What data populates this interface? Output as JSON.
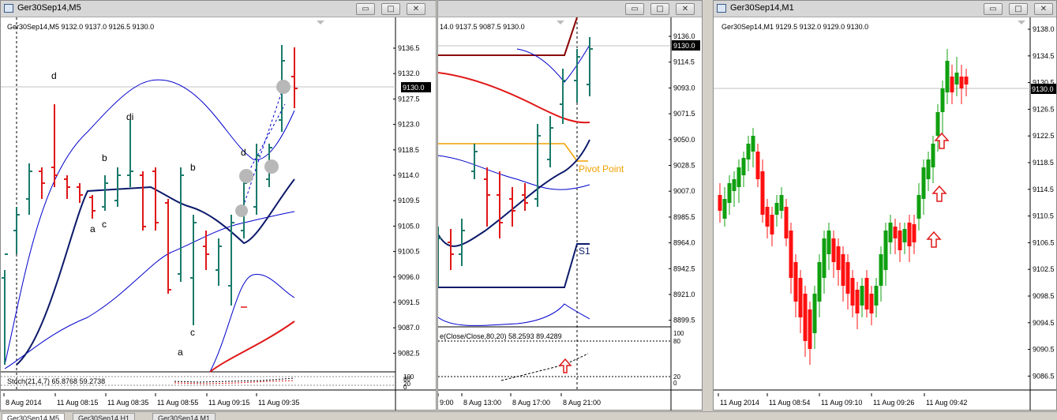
{
  "windows": [
    {
      "title": "Ger30Sep14,M5",
      "info": "Ger30Sep14,M5  9132.0 9137.0 9126.5 9130.0",
      "sub_info": "Stoch(21,4,7) 65.8768 59.2738",
      "price_ticks": [
        "9136.5",
        "9132.0",
        "9127.5",
        "9123.0",
        "9118.5",
        "9114.0",
        "9109.5",
        "9105.0",
        "9100.5",
        "9096.0",
        "9091.5",
        "9087.0",
        "9082.5"
      ],
      "current_price": "9130.0",
      "sub_ticks": [
        "100",
        "80",
        "20",
        "0"
      ],
      "time_ticks": [
        "8 Aug 2014",
        "11 Aug 08:15",
        "11 Aug 08:35",
        "11 Aug 08:55",
        "11 Aug 09:15",
        "11 Aug 09:35"
      ],
      "labels": [
        "d",
        "di",
        "b",
        "b",
        "d",
        "a",
        "c",
        "a",
        "c"
      ]
    },
    {
      "title": "",
      "info": "14.0 9137.5 9087.5 9130.0",
      "sub_info": "e(Close/Close,80,20) 58.2593 89.4289",
      "price_ticks": [
        "9136.0",
        "9114.5",
        "9093.0",
        "9071.5",
        "9050.0",
        "9028.5",
        "9007.0",
        "8985.5",
        "8964.0",
        "8942.5",
        "8921.0",
        "8899.5"
      ],
      "current_price": "9130.0",
      "sub_ticks": [
        "100",
        "80",
        "20",
        "0"
      ],
      "time_ticks": [
        "9:00",
        "8 Aug 13:00",
        "8 Aug 17:00",
        "8 Aug 21:00"
      ],
      "pivot_label": "Pivot Point",
      "s1_label": "S1"
    },
    {
      "title": "Ger30Sep14,M1",
      "info": "Ger30Sep14,M1  9129.5 9132.0 9129.0 9130.0",
      "price_ticks": [
        "9138.0",
        "9134.5",
        "9130.5",
        "9126.5",
        "9122.5",
        "9118.5",
        "9114.5",
        "9110.5",
        "9106.5",
        "9102.5",
        "9098.5",
        "9094.5",
        "9090.5",
        "9086.5"
      ],
      "current_price": "9130.0",
      "time_ticks": [
        "11 Aug 2014",
        "11 Aug 08:54",
        "11 Aug 09:10",
        "11 Aug 09:26",
        "11 Aug 09:42"
      ]
    }
  ],
  "window_buttons": {
    "minimize": "▭",
    "maximize": "□",
    "close": "✕"
  },
  "tabs": [
    "Ger30Sep14,M5",
    "Ger30Sep14,H1",
    "Ger30Sep14,M1"
  ],
  "colors": {
    "bull": "#1a7a6a",
    "bear": "#e01818",
    "m1_bull": "#10a010",
    "m1_bear": "#ff1010",
    "band": "#0000cc",
    "ma": "#0c1a6a",
    "pivot": "#f0a000"
  }
}
